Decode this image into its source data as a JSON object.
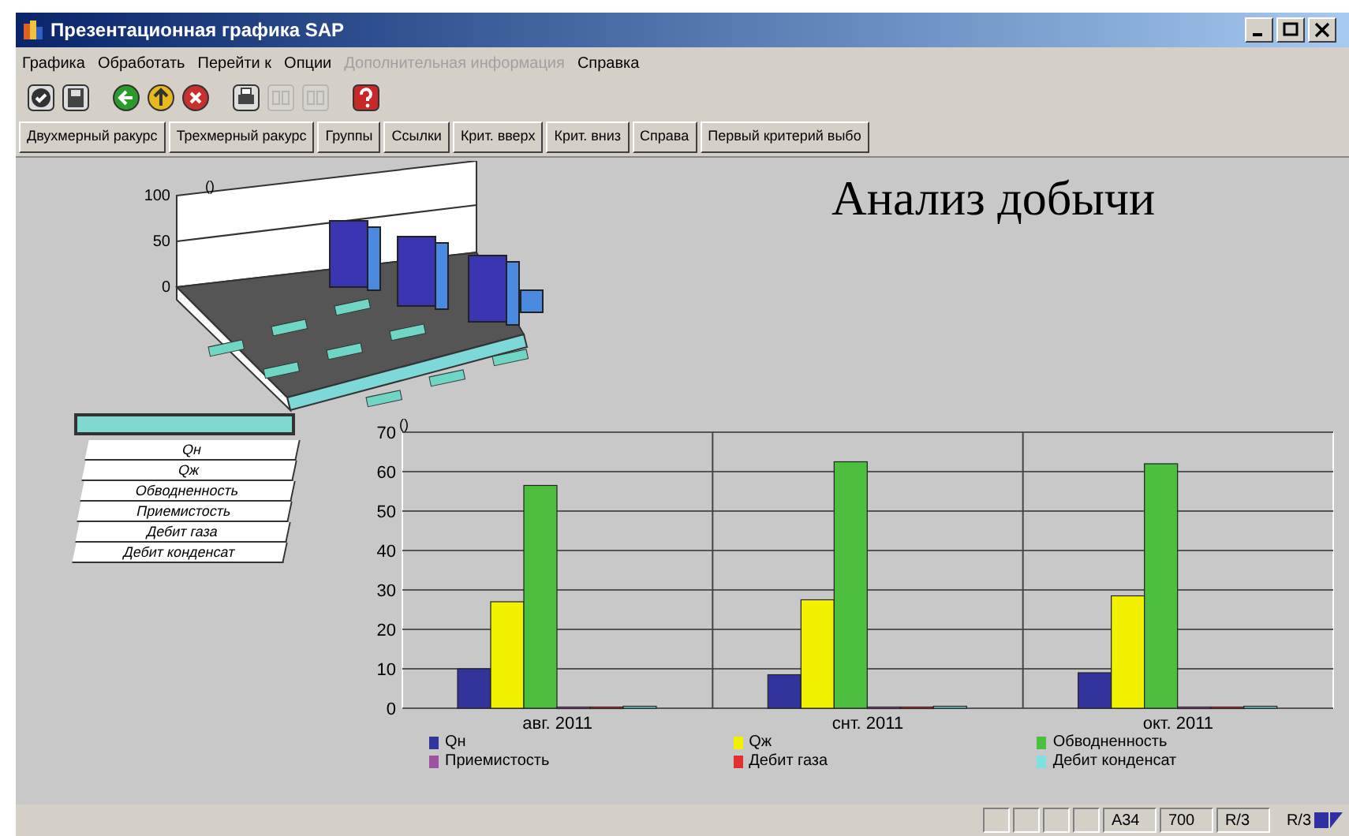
{
  "window": {
    "title": "Презентационная графика SAP"
  },
  "menu": [
    {
      "label": "Графика",
      "disabled": false
    },
    {
      "label": "Обработать",
      "disabled": false
    },
    {
      "label": "Перейти к",
      "disabled": false
    },
    {
      "label": "Опции",
      "disabled": false
    },
    {
      "label": "Дополнительная информация",
      "disabled": true
    },
    {
      "label": "Справка",
      "disabled": false
    }
  ],
  "toolbar": [
    {
      "kind": "check",
      "disabled": false
    },
    {
      "kind": "save",
      "disabled": false
    },
    {
      "kind": "back",
      "disabled": false
    },
    {
      "kind": "exit",
      "disabled": false
    },
    {
      "kind": "cancel",
      "disabled": false
    },
    {
      "kind": "print",
      "disabled": false
    },
    {
      "kind": "find",
      "disabled": true
    },
    {
      "kind": "find-next",
      "disabled": true
    },
    {
      "kind": "help",
      "disabled": false
    }
  ],
  "buttons": [
    "Двухмерный ракурс",
    "Трехмерный ракурс",
    "Группы",
    "Ссылки",
    "Крит. вверх",
    "Крит. вниз",
    "Справа",
    "Первый критерий выбо"
  ],
  "chart_3d": {
    "unit": "()",
    "ticks": [
      "100",
      "50",
      "0"
    ]
  },
  "heading": "Анализ добычи",
  "legend_table": {
    "rows": [
      "Qн",
      "Qж",
      "Обводненность",
      "Приемистость",
      "Дебит газа",
      "Дебит конденсат"
    ]
  },
  "chart": {
    "chart_data": {
      "type": "bar",
      "grid": true,
      "ylabel": "()",
      "categories": [
        "авг. 2011",
        "снт. 2011",
        "окт. 2011"
      ],
      "ylim": [
        0,
        70
      ],
      "yticks": [
        0,
        10,
        20,
        30,
        40,
        50,
        60,
        70
      ],
      "series": [
        {
          "name": "Qн",
          "color": "#33339c",
          "values": [
            10,
            8.5,
            9
          ]
        },
        {
          "name": "Qж",
          "color": "#f2f200",
          "values": [
            27,
            27.5,
            28.5
          ]
        },
        {
          "name": "Обводненность",
          "color": "#4cbf3f",
          "values": [
            56.5,
            62.5,
            62
          ]
        },
        {
          "name": "Приемистость",
          "color": "#a050a0",
          "values": [
            0.3,
            0.3,
            0.3
          ]
        },
        {
          "name": "Дебит газа",
          "color": "#e03030",
          "values": [
            0.3,
            0.3,
            0.3
          ]
        },
        {
          "name": "Дебит конденсат",
          "color": "#80e0e0",
          "values": [
            0.5,
            0.5,
            0.5
          ]
        }
      ]
    }
  },
  "status_bar": {
    "fields": [
      "A34",
      "700",
      "R/3"
    ],
    "system": "R/3"
  }
}
